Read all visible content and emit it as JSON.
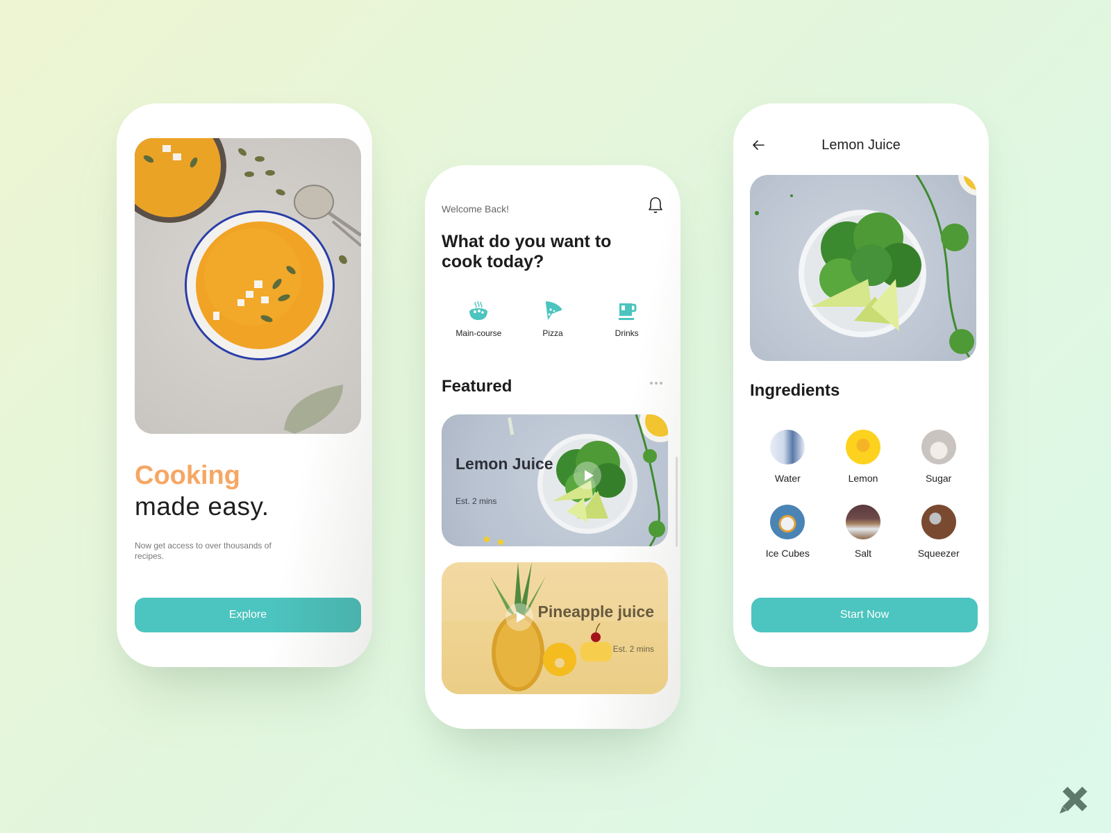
{
  "colors": {
    "accent_teal": "#4cc4bf",
    "accent_orange": "#f5a764",
    "text_dark": "#1c1c1c",
    "brand_icon": "#5e7a6c"
  },
  "onboarding": {
    "title_accent": "Cooking",
    "title_rest": "made easy.",
    "subtitle": "Now get access to over thousands of recipes.",
    "explore_label": "Explore",
    "hero_image": "pumpkin-soup-photo"
  },
  "home": {
    "greeting": "Welcome Back!",
    "notification_icon": "bell-icon",
    "question": "What do you want to cook today?",
    "categories": [
      {
        "label": "Main-course",
        "icon": "soup-bowl-icon"
      },
      {
        "label": "Pizza",
        "icon": "pizza-slice-icon"
      },
      {
        "label": "Drinks",
        "icon": "cup-icon"
      }
    ],
    "featured_title": "Featured",
    "more_icon": "more-dots-icon",
    "featured": [
      {
        "title": "Lemon Juice",
        "subtitle": "Est. 2 mins",
        "image": "lime-cilantro-photo",
        "icon": "play-icon"
      },
      {
        "title": "Pineapple juice",
        "subtitle": "Est. 2 mins",
        "image": "pineapple-photo",
        "icon": "play-icon"
      }
    ]
  },
  "detail": {
    "back_icon": "arrow-left-icon",
    "title": "Lemon Juice",
    "image": "lime-cilantro-photo",
    "ingredients_title": "Ingredients",
    "ingredients": [
      {
        "label": "Water"
      },
      {
        "label": "Lemon"
      },
      {
        "label": "Sugar"
      },
      {
        "label": "Ice Cubes"
      },
      {
        "label": "Salt"
      },
      {
        "label": "Squeezer"
      }
    ],
    "start_label": "Start Now"
  },
  "brand": {
    "icon": "ruler-pencil-logo-icon"
  }
}
